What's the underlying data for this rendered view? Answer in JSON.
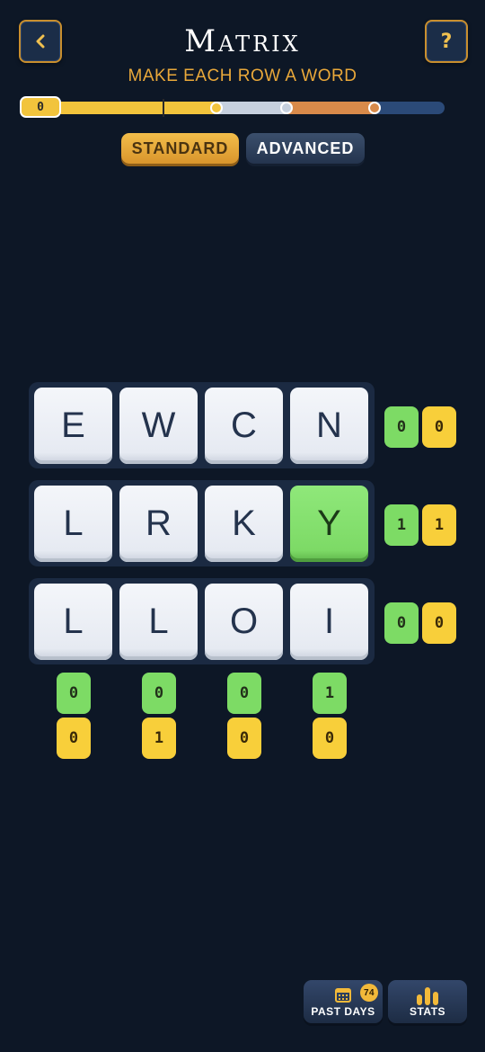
{
  "header": {
    "title": "Matrix",
    "subtitle": "MAKE EACH ROW A WORD",
    "back_icon": "chevron-left-icon",
    "help_label": "?"
  },
  "progress": {
    "score": "0",
    "milestone_colors": [
      "#f2c43c",
      "#c6d0de",
      "#d88a4a"
    ]
  },
  "modes": {
    "standard_label": "STANDARD",
    "advanced_label": "ADVANCED",
    "selected": "STANDARD"
  },
  "grid": {
    "rows": [
      {
        "tiles": [
          "E",
          "W",
          "C",
          "N"
        ],
        "correct_tiles": [],
        "green": "0",
        "yellow": "0"
      },
      {
        "tiles": [
          "L",
          "R",
          "K",
          "Y"
        ],
        "correct_tiles": [
          3
        ],
        "green": "1",
        "yellow": "1"
      },
      {
        "tiles": [
          "L",
          "L",
          "O",
          "I"
        ],
        "correct_tiles": [],
        "green": "0",
        "yellow": "0"
      }
    ],
    "columns": [
      {
        "green": "0",
        "yellow": "0"
      },
      {
        "green": "0",
        "yellow": "1"
      },
      {
        "green": "0",
        "yellow": "0"
      },
      {
        "green": "1",
        "yellow": "0"
      }
    ]
  },
  "colors": {
    "background": "#0d1726",
    "accent": "#e9a83a",
    "correct": "#7ddb65",
    "present": "#f8cf3a"
  },
  "nav": {
    "past_days_label": "PAST DAYS",
    "past_days_count": "74",
    "past_days_icon": "calendar-icon",
    "stats_label": "STATS",
    "stats_icon": "bar-chart-icon"
  }
}
